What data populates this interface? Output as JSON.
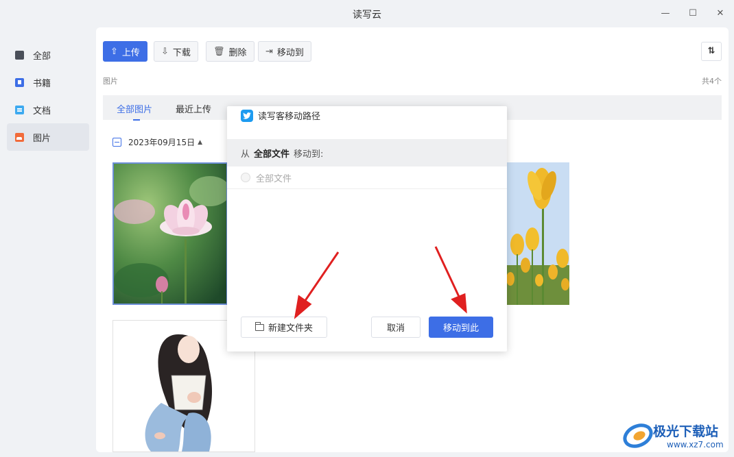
{
  "window": {
    "title": "读写云",
    "minimize_symbol": "—",
    "maximize_symbol": "☐",
    "close_symbol": "✕"
  },
  "sidebar": {
    "items": [
      {
        "label": "全部",
        "icon": "stack-icon"
      },
      {
        "label": "书籍",
        "icon": "book-icon"
      },
      {
        "label": "文档",
        "icon": "document-icon"
      },
      {
        "label": "图片",
        "icon": "image-icon",
        "active": true
      }
    ]
  },
  "toolbar": {
    "upload": "上传",
    "download": "下载",
    "delete": "删除",
    "move_to": "移动到"
  },
  "breadcrumb": "图片",
  "count": "共4个",
  "tabs": [
    "全部图片",
    "最近上传"
  ],
  "group": {
    "date": "2023年09月15日"
  },
  "dialog": {
    "title": "读写客移动路径",
    "from_prefix": "从",
    "from_folder": "全部文件",
    "from_suffix": "移动到:",
    "folders": [
      "全部文件"
    ],
    "new_folder": "新建文件夹",
    "cancel": "取消",
    "confirm": "移动到此"
  },
  "watermark": {
    "name": "极光下载站",
    "url": "www.xz7.com"
  },
  "colors": {
    "accent": "#3d6ee6",
    "annotation_arrow": "#e02020"
  }
}
